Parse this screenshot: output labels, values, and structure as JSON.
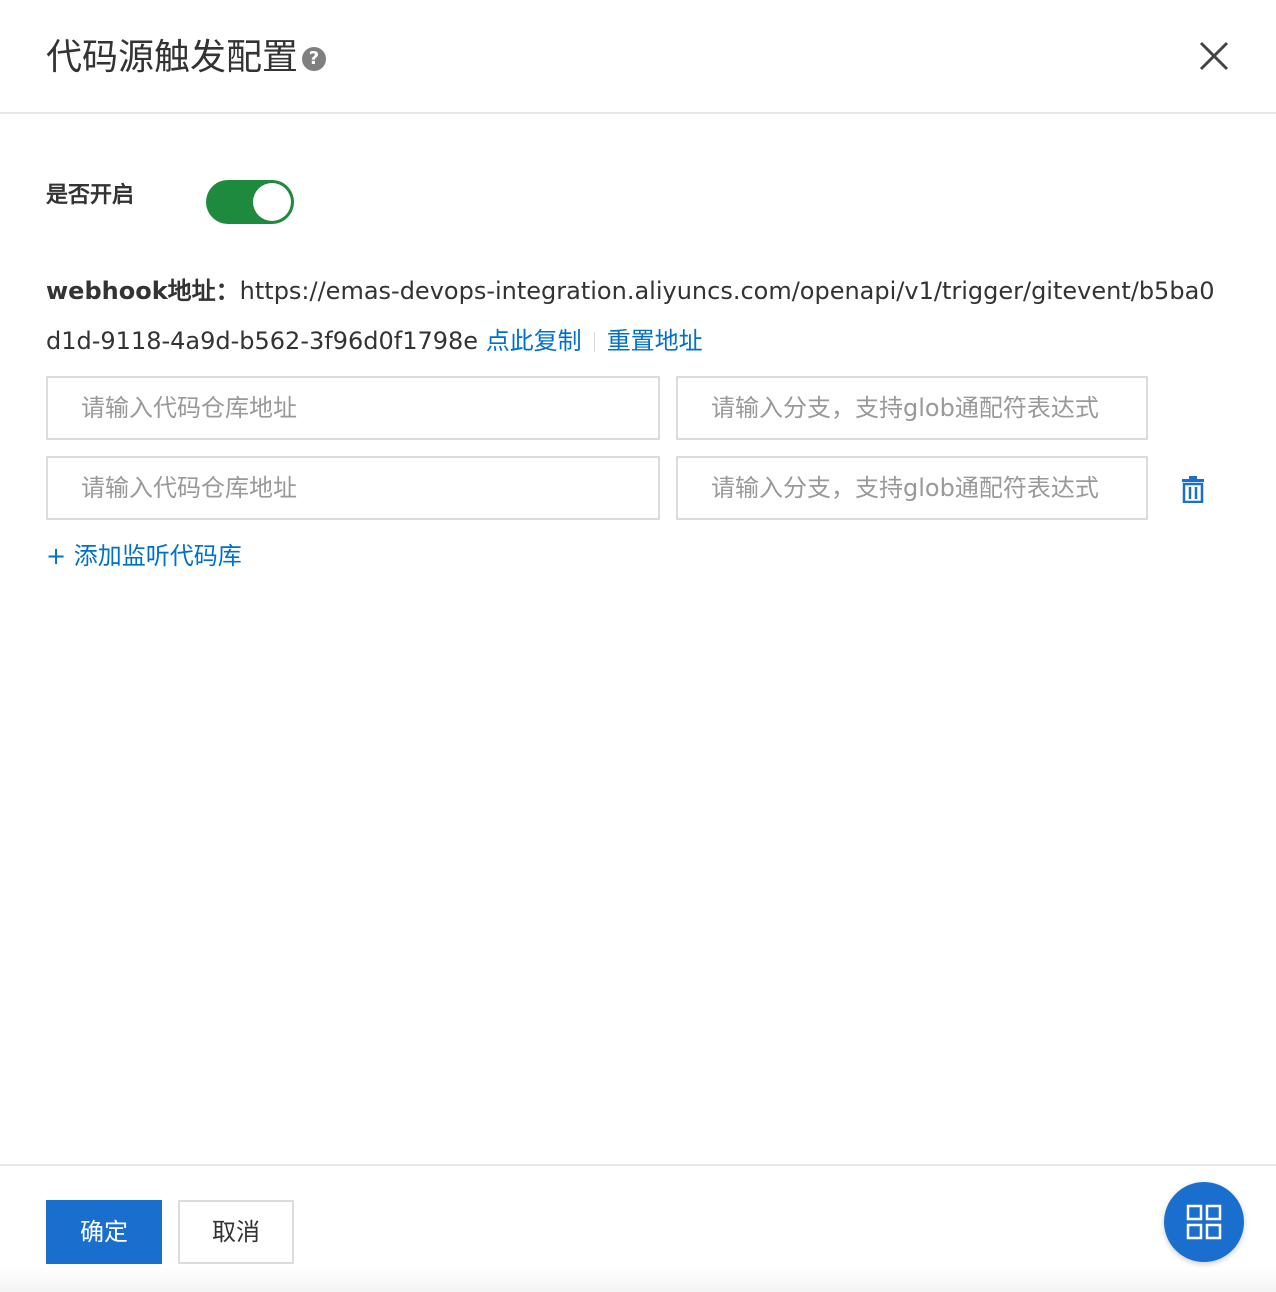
{
  "dialog": {
    "title": "代码源触发配置",
    "help_icon": "question-circle-icon",
    "close_icon": "close-icon"
  },
  "enable": {
    "label": "是否开启",
    "on": true,
    "on_color": "#1e8a3e"
  },
  "webhook": {
    "label": "webhook地址：",
    "url": "https://emas-devops-integration.aliyuncs.com/openapi/v1/trigger/gitevent/b5ba0d1d-9118-4a9d-b562-3f96d0f1798e",
    "copy_link": "点此复制",
    "reset_link": "重置地址"
  },
  "repos": [
    {
      "repo_placeholder": "请输入代码仓库地址",
      "branch_placeholder": "请输入分支，支持glob通配符表达式",
      "deletable": false
    },
    {
      "repo_placeholder": "请输入代码仓库地址",
      "branch_placeholder": "请输入分支，支持glob通配符表达式",
      "deletable": true
    }
  ],
  "add_repo_link": "+ 添加监听代码库",
  "footer": {
    "ok_label": "确定",
    "cancel_label": "取消"
  },
  "fab_icon": "grid-apps-icon",
  "colors": {
    "primary": "#1a6fce",
    "link": "#0070cc"
  }
}
